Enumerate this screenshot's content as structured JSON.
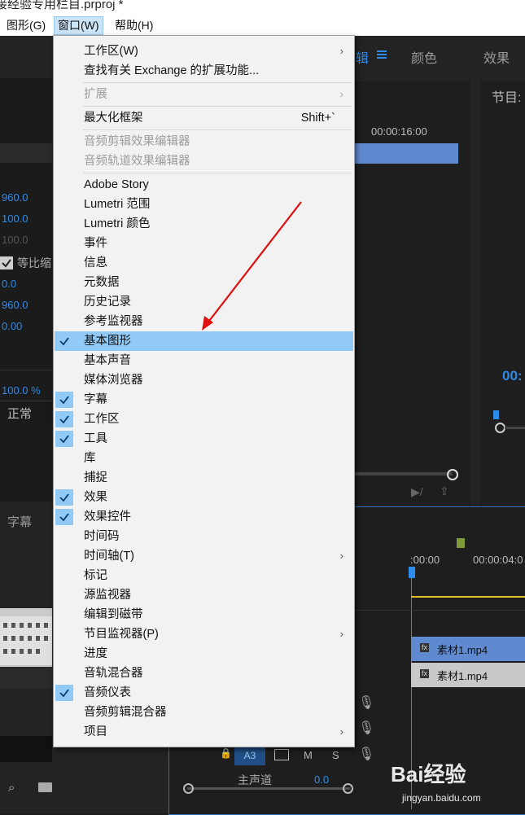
{
  "title": "接经验专用栏目.prproj *",
  "menubar": {
    "items": [
      {
        "label": "图形(G)"
      },
      {
        "label": "窗口(W)"
      },
      {
        "label": "帮助(H)"
      }
    ]
  },
  "workspace_tabs": {
    "edit": "辑",
    "color": "颜色",
    "effects": "效果"
  },
  "program_monitor": {
    "title": "节目:",
    "timecode": "00:"
  },
  "source_panel": {
    "timecode": "00:00:16:00"
  },
  "effect_controls": {
    "values": [
      "960.0",
      "100.0",
      "100.0",
      "0.0",
      "960.0",
      "0.00",
      "100.0 %"
    ],
    "uniform_scale_label": "等比缩",
    "blend_mode": "正常"
  },
  "bottom_left": {
    "tab": "字幕"
  },
  "timeline": {
    "times": [
      ":00:00",
      "00:00:04:0"
    ],
    "clips": [
      "素材1.mp4",
      "素材1.mp4"
    ],
    "track_a3": "A3",
    "track_m": "M",
    "track_s": "S",
    "master": "主声道",
    "master_val": "0.0"
  },
  "menu": {
    "items": [
      {
        "label": "工作区(W)",
        "submenu": true
      },
      {
        "label": "查找有关 Exchange 的扩展功能..."
      },
      {
        "sep": true
      },
      {
        "label": "扩展",
        "submenu": true,
        "disabled": true
      },
      {
        "sep": true
      },
      {
        "label": "最大化框架",
        "shortcut": "Shift+`"
      },
      {
        "sep": true
      },
      {
        "label": "音频剪辑效果编辑器",
        "disabled": true
      },
      {
        "label": "音频轨道效果编辑器",
        "disabled": true
      },
      {
        "sep": true
      },
      {
        "label": "Adobe Story"
      },
      {
        "label": "Lumetri 范围"
      },
      {
        "label": "Lumetri 颜色"
      },
      {
        "label": "事件"
      },
      {
        "label": "信息"
      },
      {
        "label": "元数据"
      },
      {
        "label": "历史记录"
      },
      {
        "label": "参考监视器"
      },
      {
        "label": "基本图形",
        "checked": true,
        "highlighted": true
      },
      {
        "label": "基本声音"
      },
      {
        "label": "媒体浏览器"
      },
      {
        "label": "字幕",
        "checked": true
      },
      {
        "label": "工作区",
        "checked": true
      },
      {
        "label": "工具",
        "checked": true
      },
      {
        "label": "库"
      },
      {
        "label": "捕捉"
      },
      {
        "label": "效果",
        "checked": true
      },
      {
        "label": "效果控件",
        "checked": true
      },
      {
        "label": "时间码"
      },
      {
        "label": "时间轴(T)",
        "submenu": true
      },
      {
        "label": "标记"
      },
      {
        "label": "源监视器"
      },
      {
        "label": "编辑到磁带"
      },
      {
        "label": "节目监视器(P)",
        "submenu": true
      },
      {
        "label": "进度"
      },
      {
        "label": "音轨混合器"
      },
      {
        "label": "音频仪表",
        "checked": true
      },
      {
        "label": "音频剪辑混合器"
      },
      {
        "label": "项目",
        "submenu": true
      }
    ]
  },
  "watermark": {
    "brand": "Bai经验",
    "url": "jingyan.baidu.com"
  },
  "colors": {
    "highlight": "#91c9f7",
    "accent_blue": "#2d8ceb",
    "arrow": "#e01010"
  }
}
